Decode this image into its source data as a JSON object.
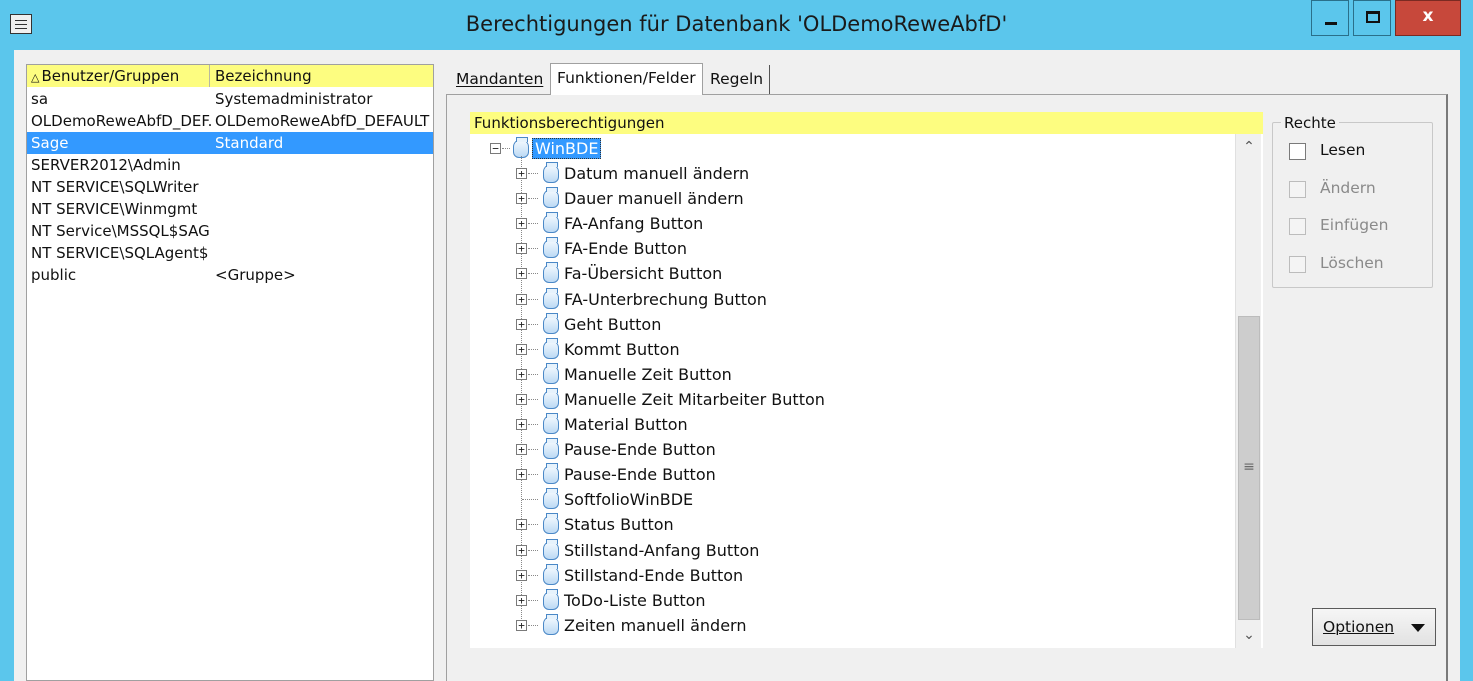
{
  "window": {
    "title": "Berechtigungen für Datenbank 'OLDemoReweAbfD'",
    "close_glyph": "x"
  },
  "userlist": {
    "columns": [
      "Benutzer/Gruppen",
      "Bezeichnung"
    ],
    "sort_indicator": "△",
    "rows": [
      {
        "name": "sa",
        "desc": "Systemadministrator"
      },
      {
        "name": "OLDemoReweAbfD_DEF.",
        "desc": "OLDemoReweAbfD_DEFAULT"
      },
      {
        "name": "Sage",
        "desc": "Standard",
        "selected": true
      },
      {
        "name": "SERVER2012\\Admin",
        "desc": ""
      },
      {
        "name": "NT SERVICE\\SQLWriter",
        "desc": ""
      },
      {
        "name": "NT SERVICE\\Winmgmt",
        "desc": ""
      },
      {
        "name": "NT Service\\MSSQL$SAGE",
        "desc": ""
      },
      {
        "name": "NT SERVICE\\SQLAgent$",
        "desc": ""
      },
      {
        "name": "public",
        "desc": "<Gruppe>"
      }
    ]
  },
  "tabs": [
    "Mandanten",
    "Funktionen/Felder",
    "Regeln"
  ],
  "active_tab": "Funktionen/Felder",
  "tree": {
    "header": "Funktionsberechtigungen",
    "root": "WinBDE",
    "children": [
      {
        "label": "Datum manuell ändern",
        "expandable": true
      },
      {
        "label": "Dauer manuell ändern",
        "expandable": true
      },
      {
        "label": "FA-Anfang Button",
        "expandable": true
      },
      {
        "label": "FA-Ende Button",
        "expandable": true
      },
      {
        "label": "Fa-Übersicht Button",
        "expandable": true
      },
      {
        "label": "FA-Unterbrechung Button",
        "expandable": true
      },
      {
        "label": "Geht Button",
        "expandable": true
      },
      {
        "label": "Kommt Button",
        "expandable": true
      },
      {
        "label": "Manuelle Zeit Button",
        "expandable": true
      },
      {
        "label": "Manuelle Zeit Mitarbeiter Button",
        "expandable": true
      },
      {
        "label": "Material Button",
        "expandable": true
      },
      {
        "label": "Pause-Ende Button",
        "expandable": true
      },
      {
        "label": "Pause-Ende Button",
        "expandable": true
      },
      {
        "label": "SoftfolioWinBDE",
        "expandable": false
      },
      {
        "label": "Status Button",
        "expandable": true
      },
      {
        "label": "Stillstand-Anfang Button",
        "expandable": true
      },
      {
        "label": "Stillstand-Ende Button",
        "expandable": true
      },
      {
        "label": "ToDo-Liste Button",
        "expandable": true
      },
      {
        "label": "Zeiten manuell ändern",
        "expandable": true
      }
    ]
  },
  "rights": {
    "legend": "Rechte",
    "items": [
      {
        "label": "Lesen",
        "checked": false,
        "enabled": true
      },
      {
        "label": "Ändern",
        "checked": false,
        "enabled": false
      },
      {
        "label": "Einfügen",
        "checked": false,
        "enabled": false
      },
      {
        "label": "Löschen",
        "checked": false,
        "enabled": false
      }
    ]
  },
  "options_button": "Optionen",
  "scrollbar": {
    "up": "⌃",
    "down": "⌄",
    "grip": "≡"
  }
}
